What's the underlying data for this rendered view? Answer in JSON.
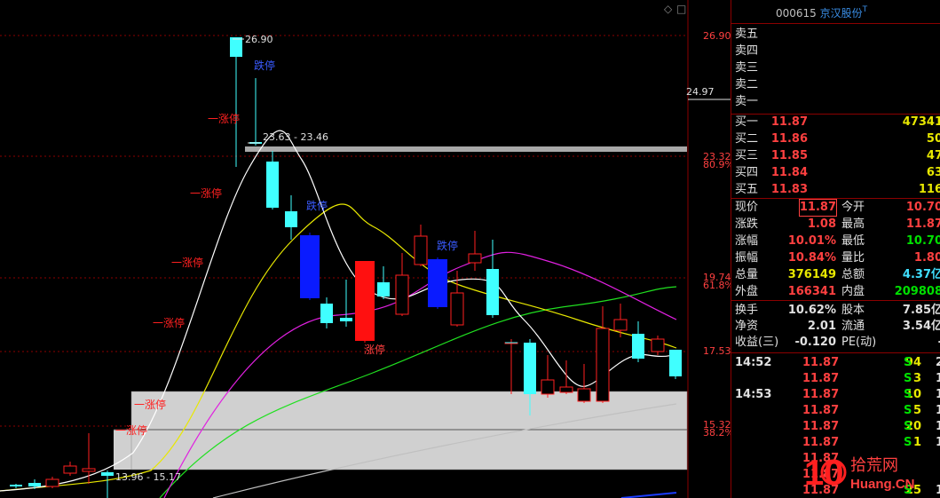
{
  "header": {
    "code": "000615",
    "name": "京汉股份",
    "tag": "T"
  },
  "chart": {
    "window_icons": [
      "◇",
      "□"
    ],
    "price_labels": [
      {
        "text": "26.90"
      },
      {
        "text": "24.97"
      },
      {
        "text": "23.32"
      },
      {
        "text": "80.9%"
      },
      {
        "text": "19.74"
      },
      {
        "text": "61.8%"
      },
      {
        "text": "17.53"
      },
      {
        "text": "15.32"
      },
      {
        "text": "38.2%"
      }
    ],
    "annotations": {
      "peak": "26.90",
      "band_top": "23.63 - 23.46",
      "band_low": "13.96 - 15.17"
    },
    "limit_labels": {
      "up": "涨停",
      "down": "跌停",
      "up_items": [
        "一涨停",
        "一涨停",
        "一涨停",
        "一涨停",
        "一涨停",
        "一涨停"
      ]
    }
  },
  "order_book": {
    "sell": [
      {
        "label": "卖五",
        "price": "",
        "vol": ""
      },
      {
        "label": "卖四",
        "price": "",
        "vol": ""
      },
      {
        "label": "卖三",
        "price": "",
        "vol": ""
      },
      {
        "label": "卖二",
        "price": "",
        "vol": ""
      },
      {
        "label": "卖一",
        "price": "",
        "vol": ""
      }
    ],
    "buy": [
      {
        "label": "买一",
        "price": "11.87",
        "vol": "47341"
      },
      {
        "label": "买二",
        "price": "11.86",
        "vol": "50"
      },
      {
        "label": "买三",
        "price": "11.85",
        "vol": "47"
      },
      {
        "label": "买四",
        "price": "11.84",
        "vol": "63"
      },
      {
        "label": "买五",
        "price": "11.83",
        "vol": "116"
      }
    ]
  },
  "quote": {
    "rows": [
      {
        "l1": "现价",
        "v1": "11.87",
        "l2": "今开",
        "v2": "10.70"
      },
      {
        "l1": "涨跌",
        "v1": "1.08",
        "l2": "最高",
        "v2": "11.87"
      },
      {
        "l1": "涨幅",
        "v1": "10.01%",
        "l2": "最低",
        "v2": "10.70"
      },
      {
        "l1": "振幅",
        "v1": "10.84%",
        "l2": "量比",
        "v2": "1.80"
      },
      {
        "l1": "总量",
        "v1": "376149",
        "l2": "总额",
        "v2": "4.37亿"
      },
      {
        "l1": "外盘",
        "v1": "166341",
        "l2": "内盘",
        "v2": "209808"
      }
    ],
    "rows2": [
      {
        "l1": "换手",
        "v1": "10.62%",
        "l2": "股本",
        "v2": "7.85亿"
      },
      {
        "l1": "净资",
        "v1": "2.01",
        "l2": "流通",
        "v2": "3.54亿"
      },
      {
        "l1": "收益(三)",
        "v1": "-0.120",
        "l2": "PE(动)",
        "v2": "-"
      }
    ]
  },
  "ticks": [
    {
      "time": "14:52",
      "price": "11.87",
      "vol": "94",
      "side": "S",
      "n": "2"
    },
    {
      "time": "",
      "price": "11.87",
      "vol": "3",
      "side": "S",
      "n": "1"
    },
    {
      "time": "14:53",
      "price": "11.87",
      "vol": "10",
      "side": "S",
      "n": "1"
    },
    {
      "time": "",
      "price": "11.87",
      "vol": "5",
      "side": "S",
      "n": "1"
    },
    {
      "time": "",
      "price": "11.87",
      "vol": "20",
      "side": "S",
      "n": "1"
    },
    {
      "time": "",
      "price": "11.87",
      "vol": "1",
      "side": "S",
      "n": "1"
    },
    {
      "time": "",
      "price": "11.87",
      "vol": "",
      "side": "",
      "n": ""
    },
    {
      "time": "",
      "price": "11.87",
      "vol": "",
      "side": "",
      "n": ""
    },
    {
      "time": "",
      "price": "11.87",
      "vol": "25",
      "side": "S",
      "n": "1"
    }
  ],
  "watermark": {
    "num": "10",
    "text1": "拾荒网",
    "text2": "Huang.CN"
  },
  "colors": {
    "up": "#ff2020",
    "down": "#40ffff",
    "limit_up_block": "#ff1010",
    "limit_down_block": "#0a1bff",
    "ma5": "#ffffff",
    "ma10": "#e8e800",
    "ma20": "#e020e0",
    "ma60": "#20e020"
  }
}
